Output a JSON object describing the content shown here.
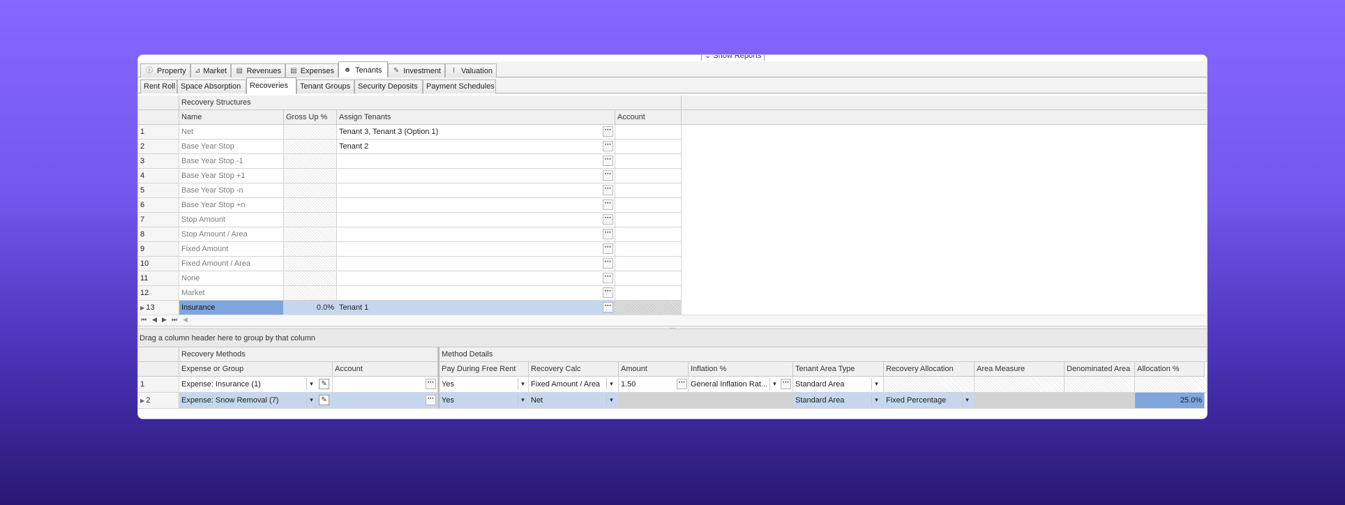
{
  "toolbar": {
    "show_reports": "Show Reports"
  },
  "main_tabs": [
    {
      "label": "Property",
      "icon": "info-icon"
    },
    {
      "label": "Market",
      "icon": "chart-icon"
    },
    {
      "label": "Revenues",
      "icon": "money-icon"
    },
    {
      "label": "Expenses",
      "icon": "money-out-icon"
    },
    {
      "label": "Tenants",
      "icon": "users-icon"
    },
    {
      "label": "Investment",
      "icon": "edit-doc-icon"
    },
    {
      "label": "Valuation",
      "icon": "measure-icon"
    }
  ],
  "sub_tabs": [
    "Rent Roll",
    "Space Absorption",
    "Recoveries",
    "Tenant Groups",
    "Security Deposits",
    "Payment Schedules"
  ],
  "recovery_structures": {
    "band_title": "Recovery Structures",
    "headers": [
      "Name",
      "Gross Up %",
      "Assign Tenants",
      "Account"
    ],
    "rows": [
      {
        "num": "1",
        "name": "Net",
        "gross": "",
        "tenants": "Tenant 3, Tenant 3 (Option 1)",
        "account": ""
      },
      {
        "num": "2",
        "name": "Base Year Stop",
        "gross": "",
        "tenants": "Tenant 2",
        "account": ""
      },
      {
        "num": "3",
        "name": "Base Year Stop -1",
        "gross": "",
        "tenants": "",
        "account": ""
      },
      {
        "num": "4",
        "name": "Base Year Stop +1",
        "gross": "",
        "tenants": "",
        "account": ""
      },
      {
        "num": "5",
        "name": "Base Year Stop -n",
        "gross": "",
        "tenants": "",
        "account": ""
      },
      {
        "num": "6",
        "name": "Base Year Stop +n",
        "gross": "",
        "tenants": "",
        "account": ""
      },
      {
        "num": "7",
        "name": "Stop Amount",
        "gross": "",
        "tenants": "",
        "account": ""
      },
      {
        "num": "8",
        "name": "Stop Amount / Area",
        "gross": "",
        "tenants": "",
        "account": ""
      },
      {
        "num": "9",
        "name": "Fixed Amount",
        "gross": "",
        "tenants": "",
        "account": ""
      },
      {
        "num": "10",
        "name": "Fixed Amount / Area",
        "gross": "",
        "tenants": "",
        "account": ""
      },
      {
        "num": "11",
        "name": "None",
        "gross": "",
        "tenants": "",
        "account": ""
      },
      {
        "num": "12",
        "name": "Market",
        "gross": "",
        "tenants": "",
        "account": ""
      },
      {
        "num": "13",
        "name": "Insurance",
        "gross": "0.0%",
        "tenants": "Tenant 1",
        "account": ""
      }
    ]
  },
  "group_bar": "Drag a column header here to group by that column",
  "recovery_methods": {
    "band_left": "Recovery Methods",
    "band_right": "Method Details",
    "headers": [
      "Expense or Group",
      "Account",
      "Pay During Free Rent",
      "Recovery Calc",
      "Amount",
      "Inflation %",
      "Tenant Area Type",
      "Recovery Allocation",
      "Area Measure",
      "Denominated Area",
      "Allocation %"
    ],
    "rows": [
      {
        "num": "1",
        "expense": "Expense: Insurance (1)",
        "account": "",
        "pay": "Yes",
        "calc": "Fixed Amount / Area",
        "amount": "1.50",
        "inflation": "General Inflation Rat...",
        "area_type": "Standard Area",
        "allocation": "",
        "area_measure": "",
        "denominated": "",
        "alloc_pct": ""
      },
      {
        "num": "2",
        "expense": "Expense: Snow Removal (7)",
        "account": "",
        "pay": "Yes",
        "calc": "Net",
        "amount": "",
        "inflation": "",
        "area_type": "Standard Area",
        "allocation": "Fixed Percentage",
        "area_measure": "",
        "denominated": "",
        "alloc_pct": "25.0%"
      }
    ]
  }
}
